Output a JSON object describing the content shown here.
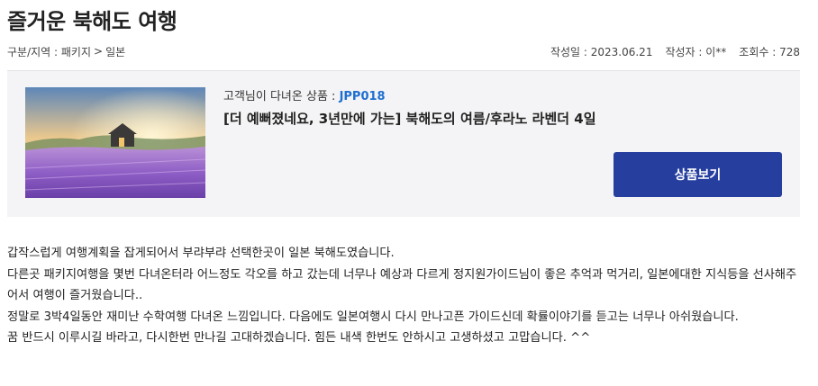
{
  "title": "즐거운 북해도 여행",
  "meta": {
    "category_label": "구분/지역 : 패키지",
    "chevron": ">",
    "region": "일본",
    "date": "작성일 : 2023.06.21",
    "author": "작성자 : 이**",
    "views": "조회수 : 728"
  },
  "product": {
    "sub_label": "고객님이 다녀온 상품 : ",
    "code": "JPP018",
    "name": "[더 예뻐졌네요, 3년만에 가는] 북해도의 여름/후라노 라벤더 4일",
    "button_label": "상품보기"
  },
  "body": {
    "paragraphs": [
      "갑작스럽게 여행계획을 잡게되어서 부랴부랴 선택한곳이 일본 북해도였습니다.",
      "다른곳 패키지여행을 몇번 다녀온터라 어느정도 각오를 하고 갔는데 너무나 예상과 다르게 정지원가이드님이 좋은 추억과 먹거리, 일본에대한 지식등을 선사해주어서 여행이 즐거웠습니다..",
      "정말로 3박4일동안 재미난 수학여행 다녀온 느낌입니다. 다음에도 일본여행시 다시 만나고픈 가이드신데 확률이야기를 듣고는 너무나 아쉬웠습니다.",
      "꿈 반드시 이루시길 바라고, 다시한번 만나길 고대하겠습니다. 힘든 내색 한번도 안하시고 고생하셨고 고맙습니다. ^^"
    ]
  }
}
